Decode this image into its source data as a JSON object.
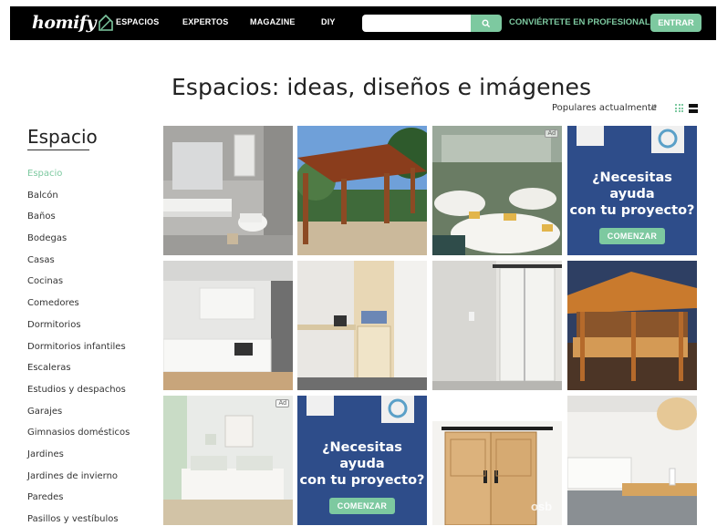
{
  "brand": {
    "logo_text": "homify"
  },
  "nav": {
    "items": [
      {
        "label": "ESPACIOS"
      },
      {
        "label": "EXPERTOS"
      },
      {
        "label": "MAGAZINE"
      },
      {
        "label": "DIY"
      }
    ],
    "search_placeholder": "",
    "pro_link": "CONVIÉRTETE EN PROFESIONAL",
    "login": "ENTRAR"
  },
  "page": {
    "title": "Espacios: ideas, diseños e imágenes",
    "sort_label": "Populares actualmente"
  },
  "sidebar": {
    "title": "Espacio",
    "items": [
      {
        "label": "Espacio",
        "active": true
      },
      {
        "label": "Balcón"
      },
      {
        "label": "Baños"
      },
      {
        "label": "Bodegas"
      },
      {
        "label": "Casas"
      },
      {
        "label": "Cocinas"
      },
      {
        "label": "Comedores"
      },
      {
        "label": "Dormitorios"
      },
      {
        "label": "Dormitorios infantiles"
      },
      {
        "label": "Escaleras"
      },
      {
        "label": "Estudios y despachos"
      },
      {
        "label": "Garajes"
      },
      {
        "label": "Gimnasios domésticos"
      },
      {
        "label": "Jardines"
      },
      {
        "label": "Jardines de invierno"
      },
      {
        "label": "Paredes"
      },
      {
        "label": "Pasillos y vestíbulos"
      }
    ]
  },
  "tiles": {
    "ad_label": "Ad",
    "promo_line1": "¿Necesitas ayuda",
    "promo_line2": "con tu proyecto?",
    "promo_button": "COMENZAR",
    "door_brand": "osb"
  },
  "colors": {
    "accent": "#7dc9a0",
    "nav_bg": "#000000",
    "promo_bg": "#2e4d8a"
  }
}
